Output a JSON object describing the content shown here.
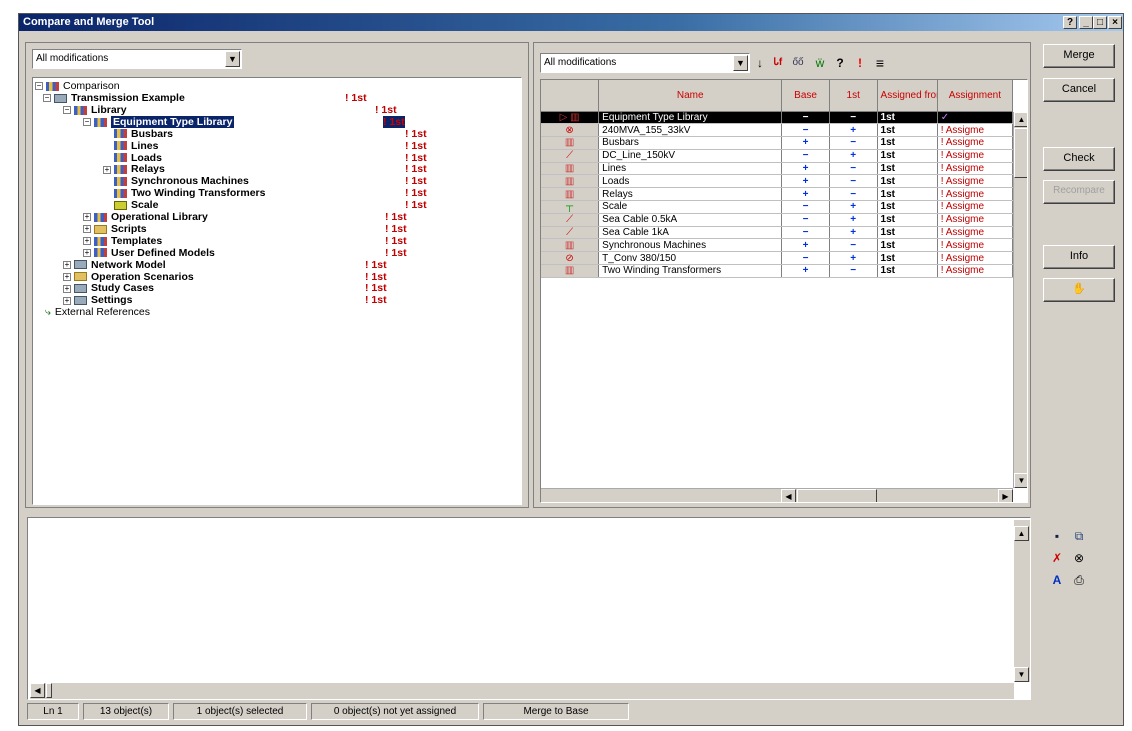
{
  "window": {
    "title": "Compare and Merge Tool",
    "help_btn": "?",
    "min_btn": "_",
    "max_btn": "□",
    "close_btn": "×"
  },
  "left_filter": {
    "value": "All modifications"
  },
  "right_filter": {
    "value": "All modifications"
  },
  "toolbar": {
    "down_icon": "↓",
    "filter_icon": "Ꮣf",
    "binoculars_icon": "ốố",
    "tree_icon": "ẅ",
    "help_icon": "?",
    "warn_icon": "!",
    "menu_icon": "≡"
  },
  "tree": {
    "root": "Comparison",
    "rows": [
      {
        "label": "Transmission Example",
        "mark": "1st"
      },
      {
        "label": "Library",
        "mark": "1st"
      },
      {
        "label": "Equipment Type Library",
        "mark": "1st"
      },
      {
        "label": "Busbars",
        "mark": "1st"
      },
      {
        "label": "Lines",
        "mark": "1st"
      },
      {
        "label": "Loads",
        "mark": "1st"
      },
      {
        "label": "Relays",
        "mark": "1st"
      },
      {
        "label": "Synchronous Machines",
        "mark": "1st"
      },
      {
        "label": "Two Winding Transformers",
        "mark": "1st"
      },
      {
        "label": "Scale",
        "mark": "1st"
      },
      {
        "label": "Operational Library",
        "mark": "1st"
      },
      {
        "label": "Scripts",
        "mark": "1st"
      },
      {
        "label": "Templates",
        "mark": "1st"
      },
      {
        "label": "User Defined Models",
        "mark": "1st"
      },
      {
        "label": "Network Model",
        "mark": "1st"
      },
      {
        "label": "Operation Scenarios",
        "mark": "1st"
      },
      {
        "label": "Study Cases",
        "mark": "1st"
      },
      {
        "label": "Settings",
        "mark": "1st"
      }
    ],
    "external": "External References"
  },
  "grid": {
    "headers": [
      "Name",
      "Base",
      "1st",
      "Assigned from",
      "Assignment"
    ],
    "rows": [
      {
        "name": "Equipment Type Library",
        "base": "−",
        "first": "−",
        "assigned": "1st",
        "assignment": "✓"
      },
      {
        "name": "240MVA_155_33kV",
        "base": "−",
        "first": "+",
        "assigned": "1st",
        "assignment": "! Assigme"
      },
      {
        "name": "Busbars",
        "base": "+",
        "first": "−",
        "assigned": "1st",
        "assignment": "! Assigme"
      },
      {
        "name": "DC_Line_150kV",
        "base": "−",
        "first": "+",
        "assigned": "1st",
        "assignment": "! Assigme"
      },
      {
        "name": "Lines",
        "base": "+",
        "first": "−",
        "assigned": "1st",
        "assignment": "! Assigme"
      },
      {
        "name": "Loads",
        "base": "+",
        "first": "−",
        "assigned": "1st",
        "assignment": "! Assigme"
      },
      {
        "name": "Relays",
        "base": "+",
        "first": "−",
        "assigned": "1st",
        "assignment": "! Assigme"
      },
      {
        "name": "Scale",
        "base": "−",
        "first": "+",
        "assigned": "1st",
        "assignment": "! Assigme"
      },
      {
        "name": "Sea Cable 0.5kA",
        "base": "−",
        "first": "+",
        "assigned": "1st",
        "assignment": "! Assigme"
      },
      {
        "name": "Sea Cable 1kA",
        "base": "−",
        "first": "+",
        "assigned": "1st",
        "assignment": "! Assigme"
      },
      {
        "name": "Synchronous Machines",
        "base": "+",
        "first": "−",
        "assigned": "1st",
        "assignment": "! Assigme"
      },
      {
        "name": "T_Conv 380/150",
        "base": "−",
        "first": "+",
        "assigned": "1st",
        "assignment": "! Assigme"
      },
      {
        "name": "Two Winding Transformers",
        "base": "+",
        "first": "−",
        "assigned": "1st",
        "assignment": "! Assigme"
      }
    ]
  },
  "buttons": {
    "merge": "Merge",
    "cancel": "Cancel",
    "check": "Check",
    "recompare": "Recompare",
    "info": "Info",
    "hand": "✋"
  },
  "status": {
    "ln": "Ln 1",
    "objects": "13 object(s)",
    "selected": "1 object(s) selected",
    "not_assigned": "0 object(s) not yet assigned",
    "merge_to": "Merge to Base"
  },
  "colors": {
    "accent": "#0a246a",
    "mark": "#c00000",
    "plus": "#0030e0"
  }
}
